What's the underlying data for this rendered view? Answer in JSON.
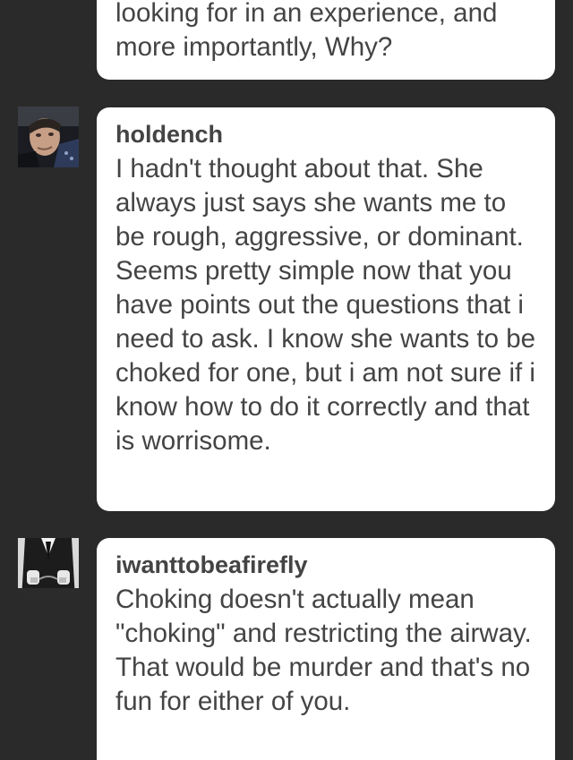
{
  "comments": [
    {
      "username": "",
      "text": "looking for in an experience, and more importantly, Why?"
    },
    {
      "username": "holdench",
      "text": "I hadn't thought about that. She always just says she wants me to be rough, aggressive, or dominant. Seems pretty simple now that you have points out the questions that i need to ask. I know she wants to be choked for one, but i am not sure if i know how to do it correctly and that is worrisome.",
      "avatar_icon": "user-photo-holdench"
    },
    {
      "username": "iwanttobeafirefly",
      "text": "Choking doesn't actually mean \"choking\" and restricting the airway. That would be murder and that's no fun for either of you.",
      "avatar_icon": "user-photo-cuffed-hands"
    }
  ],
  "colors": {
    "background": "#2a2a2a",
    "bubble": "#ffffff",
    "text": "#444444"
  }
}
